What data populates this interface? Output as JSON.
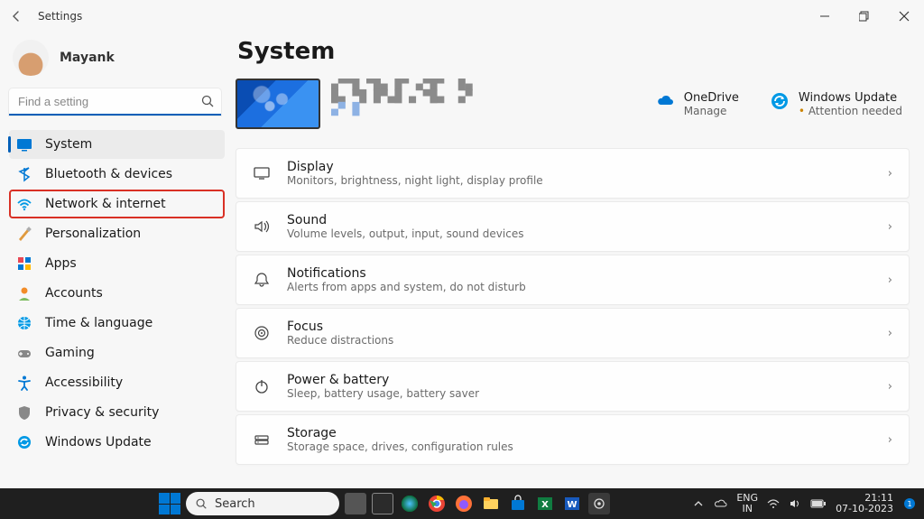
{
  "app_title": "Settings",
  "user": {
    "name": "Mayank"
  },
  "search": {
    "placeholder": "Find a setting"
  },
  "sidebar": {
    "items": [
      {
        "label": "System"
      },
      {
        "label": "Bluetooth & devices"
      },
      {
        "label": "Network & internet"
      },
      {
        "label": "Personalization"
      },
      {
        "label": "Apps"
      },
      {
        "label": "Accounts"
      },
      {
        "label": "Time & language"
      },
      {
        "label": "Gaming"
      },
      {
        "label": "Accessibility"
      },
      {
        "label": "Privacy & security"
      },
      {
        "label": "Windows Update"
      }
    ]
  },
  "page": {
    "title": "System"
  },
  "hero": {
    "onedrive": {
      "title": "OneDrive",
      "sub": "Manage"
    },
    "update": {
      "title": "Windows Update",
      "sub": "Attention needed"
    }
  },
  "cards": [
    {
      "title": "Display",
      "sub": "Monitors, brightness, night light, display profile"
    },
    {
      "title": "Sound",
      "sub": "Volume levels, output, input, sound devices"
    },
    {
      "title": "Notifications",
      "sub": "Alerts from apps and system, do not disturb"
    },
    {
      "title": "Focus",
      "sub": "Reduce distractions"
    },
    {
      "title": "Power & battery",
      "sub": "Sleep, battery usage, battery saver"
    },
    {
      "title": "Storage",
      "sub": "Storage space, drives, configuration rules"
    }
  ],
  "taskbar": {
    "search": "Search",
    "lang": {
      "l1": "ENG",
      "l2": "IN"
    },
    "clock": {
      "time": "21:11",
      "date": "07-10-2023"
    }
  }
}
